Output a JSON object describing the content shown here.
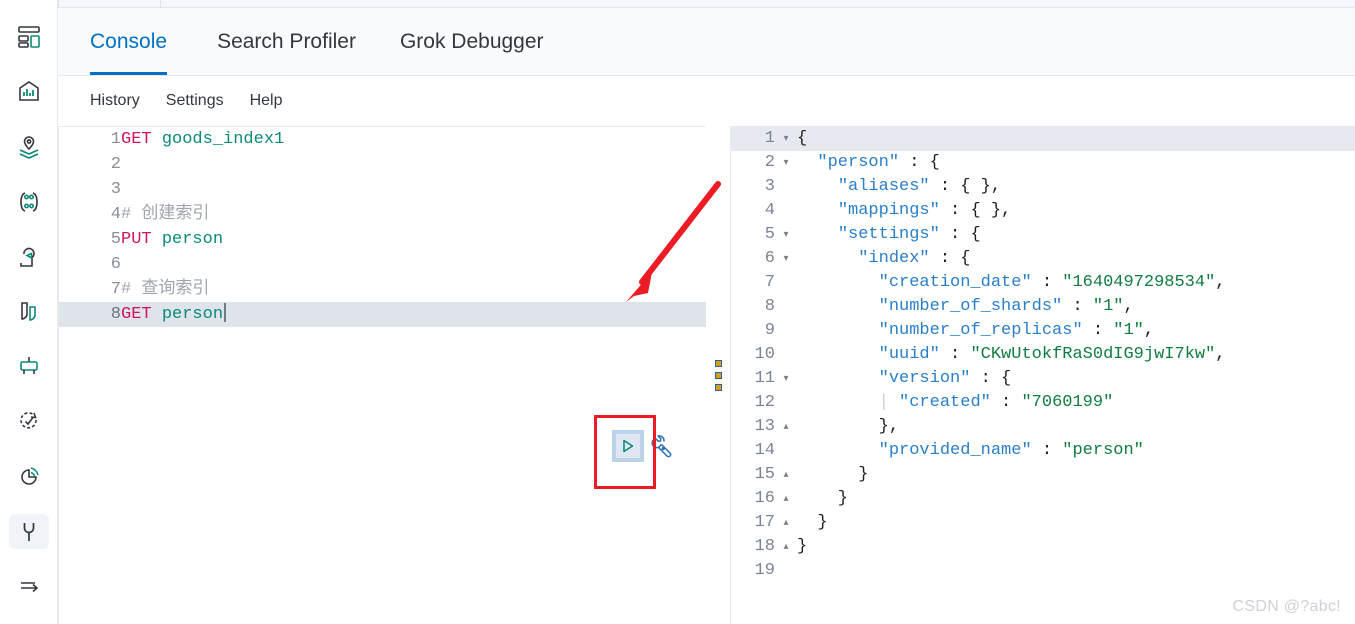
{
  "app": {
    "name": "Kibana Dev Tools Console"
  },
  "sidebar": {
    "items": [
      {
        "name": "dashboard-icon",
        "label": "Dashboard",
        "active": false
      },
      {
        "name": "visualize-icon",
        "label": "Visualize",
        "active": false
      },
      {
        "name": "maps-icon",
        "label": "Maps",
        "active": false
      },
      {
        "name": "graph-icon",
        "label": "Graph",
        "active": false
      },
      {
        "name": "machine-learning-icon",
        "label": "Machine Learning",
        "active": false
      },
      {
        "name": "infrastructure-icon",
        "label": "Infrastructure",
        "active": false
      },
      {
        "name": "logs-icon",
        "label": "Logs",
        "active": false
      },
      {
        "name": "uptime-icon",
        "label": "Uptime",
        "active": false
      },
      {
        "name": "apm-icon",
        "label": "APM",
        "active": false
      },
      {
        "name": "dev-tools-wrench-icon",
        "label": "Dev Tools",
        "active": true
      },
      {
        "name": "collapse-nav-icon",
        "label": "Collapse",
        "active": false
      }
    ]
  },
  "tabs": [
    {
      "label": "Console",
      "selected": true
    },
    {
      "label": "Search Profiler",
      "selected": false
    },
    {
      "label": "Grok Debugger",
      "selected": false
    }
  ],
  "submenu": [
    {
      "label": "History"
    },
    {
      "label": "Settings"
    },
    {
      "label": "Help"
    }
  ],
  "request_editor": {
    "lines": [
      {
        "n": "1",
        "tokens": [
          {
            "t": "GET ",
            "c": "kw"
          },
          {
            "t": "goods_index1",
            "c": "idx"
          }
        ],
        "highlight": false
      },
      {
        "n": "2",
        "tokens": [],
        "highlight": false
      },
      {
        "n": "3",
        "tokens": [],
        "highlight": false
      },
      {
        "n": "4",
        "tokens": [
          {
            "t": "# 创建索引",
            "c": "cmt"
          }
        ],
        "highlight": false
      },
      {
        "n": "5",
        "tokens": [
          {
            "t": "PUT ",
            "c": "kw"
          },
          {
            "t": "person",
            "c": "idx"
          }
        ],
        "highlight": false
      },
      {
        "n": "6",
        "tokens": [],
        "highlight": false
      },
      {
        "n": "7",
        "tokens": [
          {
            "t": "# 查询索引",
            "c": "cmt"
          }
        ],
        "highlight": false
      },
      {
        "n": "8",
        "tokens": [
          {
            "t": "GET ",
            "c": "kw"
          },
          {
            "t": "person",
            "c": "idx"
          }
        ],
        "highlight": true,
        "caret": true
      }
    ]
  },
  "actions": {
    "play_button": {
      "name": "run-request-play-button",
      "glyph": "▷",
      "color": "#0b8a7a"
    },
    "wrench_button": {
      "name": "request-options-wrench-icon",
      "color": "#2a6fb5"
    }
  },
  "annotation": {
    "red_box": {
      "color": "#ed1c24",
      "note": "highlight around run button"
    },
    "red_arrow": {
      "color": "#ed1c24"
    }
  },
  "splitter": {
    "name": "pane-drag-handle"
  },
  "response_editor": {
    "lines": [
      {
        "n": "1",
        "fold": "▾",
        "tokens": [
          {
            "t": "{",
            "c": "jpun"
          }
        ],
        "highlight": true
      },
      {
        "n": "2",
        "fold": "▾",
        "tokens": [
          {
            "t": "  ",
            "c": "jpun"
          },
          {
            "t": "\"person\"",
            "c": "jkey"
          },
          {
            "t": " : {",
            "c": "jpun"
          }
        ],
        "highlight": false
      },
      {
        "n": "3",
        "fold": "",
        "tokens": [
          {
            "t": "    ",
            "c": "jpun"
          },
          {
            "t": "\"aliases\"",
            "c": "jkey"
          },
          {
            "t": " : { },",
            "c": "jpun"
          }
        ],
        "highlight": false
      },
      {
        "n": "4",
        "fold": "",
        "tokens": [
          {
            "t": "    ",
            "c": "jpun"
          },
          {
            "t": "\"mappings\"",
            "c": "jkey"
          },
          {
            "t": " : { },",
            "c": "jpun"
          }
        ],
        "highlight": false
      },
      {
        "n": "5",
        "fold": "▾",
        "tokens": [
          {
            "t": "    ",
            "c": "jpun"
          },
          {
            "t": "\"settings\"",
            "c": "jkey"
          },
          {
            "t": " : {",
            "c": "jpun"
          }
        ],
        "highlight": false
      },
      {
        "n": "6",
        "fold": "▾",
        "tokens": [
          {
            "t": "      ",
            "c": "jpun"
          },
          {
            "t": "\"index\"",
            "c": "jkey"
          },
          {
            "t": " : {",
            "c": "jpun"
          }
        ],
        "highlight": false
      },
      {
        "n": "7",
        "fold": "",
        "tokens": [
          {
            "t": "        ",
            "c": "jpun"
          },
          {
            "t": "\"creation_date\"",
            "c": "jkey"
          },
          {
            "t": " : ",
            "c": "jpun"
          },
          {
            "t": "\"1640497298534\"",
            "c": "jstr"
          },
          {
            "t": ",",
            "c": "jpun"
          }
        ],
        "highlight": false
      },
      {
        "n": "8",
        "fold": "",
        "tokens": [
          {
            "t": "        ",
            "c": "jpun"
          },
          {
            "t": "\"number_of_shards\"",
            "c": "jkey"
          },
          {
            "t": " : ",
            "c": "jpun"
          },
          {
            "t": "\"1\"",
            "c": "jstr"
          },
          {
            "t": ",",
            "c": "jpun"
          }
        ],
        "highlight": false
      },
      {
        "n": "9",
        "fold": "",
        "tokens": [
          {
            "t": "        ",
            "c": "jpun"
          },
          {
            "t": "\"number_of_replicas\"",
            "c": "jkey"
          },
          {
            "t": " : ",
            "c": "jpun"
          },
          {
            "t": "\"1\"",
            "c": "jstr"
          },
          {
            "t": ",",
            "c": "jpun"
          }
        ],
        "highlight": false
      },
      {
        "n": "10",
        "fold": "",
        "tokens": [
          {
            "t": "        ",
            "c": "jpun"
          },
          {
            "t": "\"uuid\"",
            "c": "jkey"
          },
          {
            "t": " : ",
            "c": "jpun"
          },
          {
            "t": "\"CKwUtokfRaS0dIG9jwI7kw\"",
            "c": "jstr"
          },
          {
            "t": ",",
            "c": "jpun"
          }
        ],
        "highlight": false
      },
      {
        "n": "11",
        "fold": "▾",
        "tokens": [
          {
            "t": "        ",
            "c": "jpun"
          },
          {
            "t": "\"version\"",
            "c": "jkey"
          },
          {
            "t": " : {",
            "c": "jpun"
          }
        ],
        "highlight": false
      },
      {
        "n": "12",
        "fold": "",
        "tokens": [
          {
            "t": "        | ",
            "c": "guide"
          },
          {
            "t": "\"created\"",
            "c": "jkey"
          },
          {
            "t": " : ",
            "c": "jpun"
          },
          {
            "t": "\"7060199\"",
            "c": "jstr"
          }
        ],
        "highlight": false
      },
      {
        "n": "13",
        "fold": "▴",
        "tokens": [
          {
            "t": "        },",
            "c": "jpun"
          }
        ],
        "highlight": false
      },
      {
        "n": "14",
        "fold": "",
        "tokens": [
          {
            "t": "        ",
            "c": "jpun"
          },
          {
            "t": "\"provided_name\"",
            "c": "jkey"
          },
          {
            "t": " : ",
            "c": "jpun"
          },
          {
            "t": "\"person\"",
            "c": "jstr"
          }
        ],
        "highlight": false
      },
      {
        "n": "15",
        "fold": "▴",
        "tokens": [
          {
            "t": "      }",
            "c": "jpun"
          }
        ],
        "highlight": false
      },
      {
        "n": "16",
        "fold": "▴",
        "tokens": [
          {
            "t": "    }",
            "c": "jpun"
          }
        ],
        "highlight": false
      },
      {
        "n": "17",
        "fold": "▴",
        "tokens": [
          {
            "t": "  }",
            "c": "jpun"
          }
        ],
        "highlight": false
      },
      {
        "n": "18",
        "fold": "▴",
        "tokens": [
          {
            "t": "}",
            "c": "jpun"
          }
        ],
        "highlight": false
      },
      {
        "n": "19",
        "fold": "",
        "tokens": [],
        "highlight": false
      }
    ]
  },
  "watermark": {
    "text": "CSDN @?abc!"
  }
}
